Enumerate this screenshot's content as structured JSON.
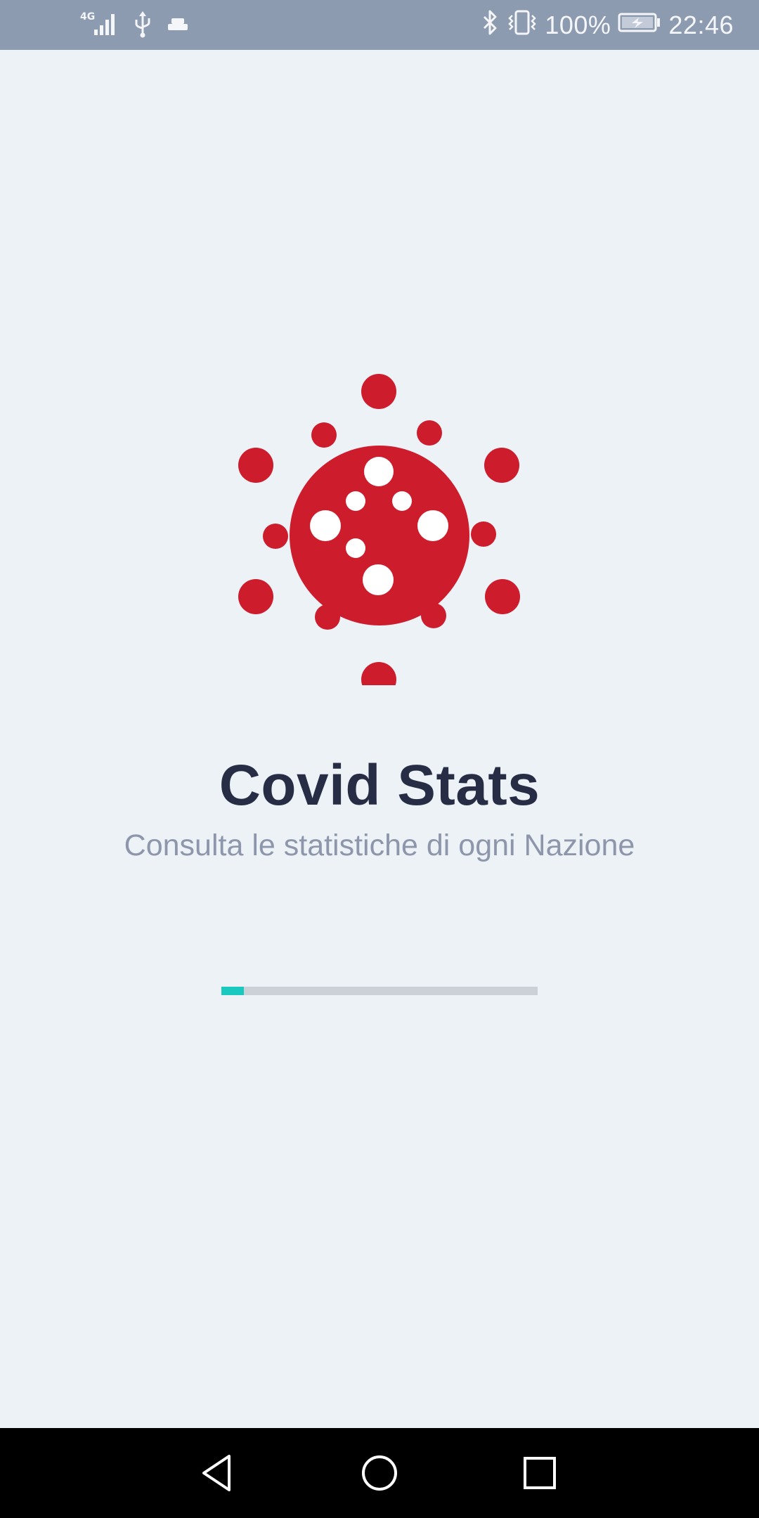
{
  "status_bar": {
    "network": "4G",
    "battery_percent": "100%",
    "time": "22:46",
    "icons": [
      "signal-icon",
      "usb-icon",
      "notification-icon",
      "bluetooth-icon",
      "vibrate-icon",
      "battery-charging-icon"
    ]
  },
  "splash": {
    "title": "Covid Stats",
    "subtitle": "Consulta le statistiche di ogni Nazione",
    "logo_icon": "virus-icon",
    "progress": 0.07
  },
  "colors": {
    "accent": "#19c9bf",
    "logo": "#cd1c2c",
    "title": "#272d45",
    "subtitle": "#8d96ab",
    "background": "#edf2f7",
    "status_bar": "#8d9bb1"
  },
  "nav_bar": {
    "icons": [
      "back-icon",
      "home-icon",
      "recents-icon"
    ]
  }
}
